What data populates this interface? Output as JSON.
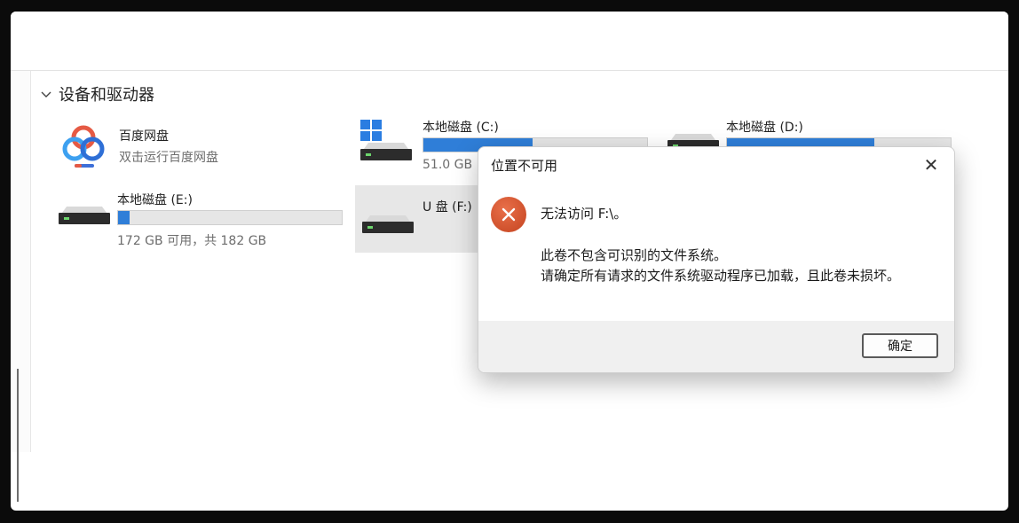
{
  "section": {
    "title": "设备和驱动器"
  },
  "drives": [
    {
      "id": "baidu",
      "name": "百度网盘",
      "sub": "双击运行百度网盘"
    },
    {
      "id": "c",
      "name": "本地磁盘 (C:)",
      "sub": "51.0 GB",
      "usage": 0.49
    },
    {
      "id": "d",
      "name": "本地磁盘 (D:)",
      "usage": 0.66
    },
    {
      "id": "e",
      "name": "本地磁盘 (E:)",
      "sub": "172 GB 可用，共 182 GB",
      "usage": 0.05
    },
    {
      "id": "f",
      "name": "U 盘 (F:)"
    }
  ],
  "dialog": {
    "title": "位置不可用",
    "close": "✕",
    "line1": "无法访问 F:\\。",
    "line2": "此卷不包含可识别的文件系统。",
    "line3": "请确定所有请求的文件系统驱动程序已加载，且此卷未损坏。",
    "ok": "确定"
  },
  "colors": {
    "bar_fill": "#2f7ed8",
    "error": "#d2522d"
  }
}
